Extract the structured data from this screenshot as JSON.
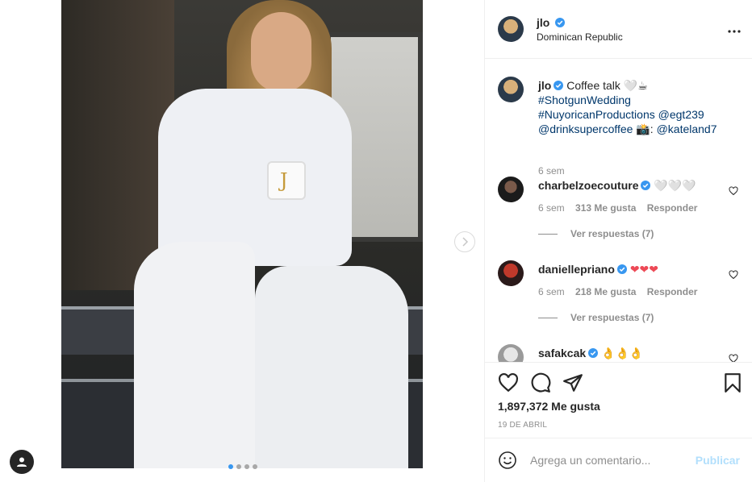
{
  "post": {
    "media": {
      "mug_letter": "J",
      "carousel_dots": 4,
      "active_dot": 0
    },
    "author": {
      "username": "jlo",
      "location": "Dominican Republic",
      "verified": true
    },
    "caption": {
      "username": "jlo",
      "text_prefix": "Coffee talk 🤍☕",
      "tags": [
        "#ShotgunWedding",
        "#NuyoricanProductions",
        "@egt239",
        "@drinksupercoffee",
        "📸: ",
        "@kateland7"
      ],
      "time": "6 sem"
    },
    "comments": [
      {
        "username": "charbelzoecouture",
        "text": "🤍🤍🤍",
        "time": "6 sem",
        "likes": "313 Me gusta",
        "reply_label": "Responder",
        "replies_label": "Ver respuestas (7)"
      },
      {
        "username": "daniellepriano",
        "text": "❤❤❤",
        "time": "6 sem",
        "likes": "218 Me gusta",
        "reply_label": "Responder",
        "replies_label": "Ver respuestas (7)"
      },
      {
        "username": "safakcak",
        "text": "👌👌👌"
      }
    ],
    "likes_count": "1,897,372 Me gusta",
    "date": "19 DE ABRIL",
    "comment_input": {
      "placeholder": "Agrega un comentario...",
      "publish_label": "Publicar"
    }
  },
  "colors": {
    "verified": "#3897f0",
    "link": "#00376b",
    "muted": "#8e8e8e",
    "publish_disabled": "#b2dffc",
    "heart_red": "#ed4956"
  },
  "icons": {
    "header_more": "more-horizontal-icon",
    "like": "heart-outline-icon",
    "comment": "comment-bubble-icon",
    "share": "paper-plane-icon",
    "save": "bookmark-icon",
    "emoji": "smiley-icon",
    "next": "chevron-right-icon",
    "profile": "user-icon"
  }
}
